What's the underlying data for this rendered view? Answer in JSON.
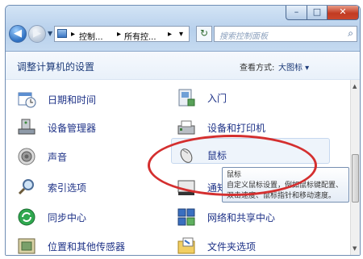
{
  "window": {
    "controls": {
      "minimize": "–",
      "maximize": "□",
      "close": "✕"
    }
  },
  "nav": {
    "back_icon": "◀",
    "forward_icon": "▶",
    "recent_icon": "▼"
  },
  "address": {
    "segments": [
      "控制...",
      "所有控..."
    ],
    "separator": "▸",
    "dropdown": "▾"
  },
  "refresh_icon": "↻",
  "search": {
    "placeholder": "搜索控制面板",
    "icon": "⌕"
  },
  "header": {
    "title": "调整计算机的设置",
    "view_by_label": "查看方式:",
    "view_by_value": "大图标 ▾"
  },
  "items": {
    "left": [
      {
        "label": "日期和时间",
        "icon": "calendar-clock-icon"
      },
      {
        "label": "设备管理器",
        "icon": "device-manager-icon"
      },
      {
        "label": "声音",
        "icon": "speaker-icon"
      },
      {
        "label": "索引选项",
        "icon": "magnifier-icon"
      },
      {
        "label": "同步中心",
        "icon": "sync-icon"
      },
      {
        "label": "位置和其他传感器",
        "icon": "sensor-icon"
      }
    ],
    "right": [
      {
        "label": "入门",
        "icon": "getting-started-icon"
      },
      {
        "label": "设备和打印机",
        "icon": "printer-icon"
      },
      {
        "label": "鼠标",
        "icon": "mouse-icon"
      },
      {
        "label": "通知",
        "icon": "notification-icon"
      },
      {
        "label": "网络和共享中心",
        "icon": "network-icon"
      },
      {
        "label": "文件夹选项",
        "icon": "folder-icon"
      }
    ]
  },
  "tooltip": {
    "title": "鼠标",
    "line1": "自定义鼠标设置，例如鼠标键配置、",
    "line2": "双击速度、鼠标指针和移动速度。"
  },
  "scrollbar": {
    "up": "▲",
    "down": "▼"
  },
  "colors": {
    "link": "#1e3287",
    "annotation": "#d42f2f",
    "title_bar": "#b7d0ec"
  }
}
